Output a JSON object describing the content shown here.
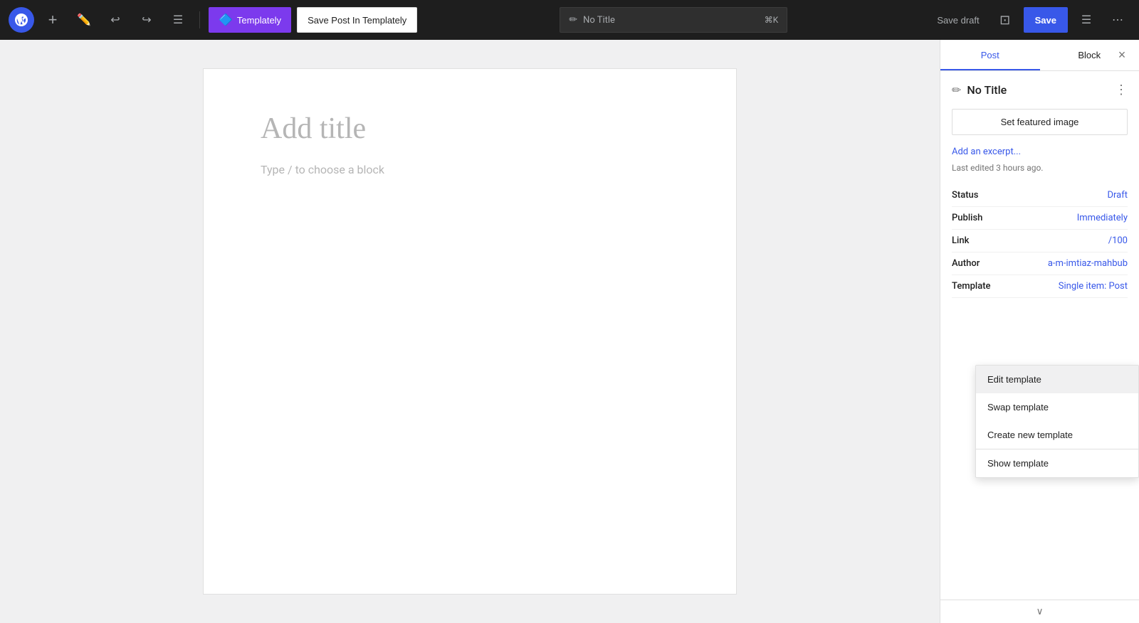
{
  "toolbar": {
    "wp_logo": "W",
    "add_label": "+",
    "edit_label": "✏",
    "undo_label": "↩",
    "redo_label": "↪",
    "list_label": "☰",
    "templately_label": "Templately",
    "save_templately_label": "Save Post In Templately",
    "title_placeholder": "No Title",
    "shortcut": "⌘K",
    "save_draft_label": "Save draft",
    "save_label": "Save",
    "preview_icon": "⊡",
    "settings_icon": "☰",
    "more_icon": "⋯"
  },
  "editor": {
    "title_placeholder": "Add title",
    "body_placeholder": "Type / to choose a block"
  },
  "sidebar": {
    "tab_post": "Post",
    "tab_block": "Block",
    "close_icon": "×",
    "pencil_icon": "✏",
    "post_title": "No Title",
    "more_icon": "⋮",
    "featured_image_btn": "Set featured image",
    "add_excerpt_link": "Add an excerpt...",
    "last_edited": "Last edited 3 hours ago.",
    "status_label": "Status",
    "status_value": "Draft",
    "publish_label": "Publish",
    "publish_value": "Immediately",
    "link_label": "Link",
    "link_value": "/100",
    "author_label": "Author",
    "author_value": "a-m-imtiaz-mahbub",
    "template_label": "Template",
    "template_value": "Single item: Post",
    "scroll_down_icon": "∨"
  },
  "template_dropdown": {
    "edit_template": "Edit template",
    "swap_template": "Swap template",
    "create_new_template": "Create new template",
    "show_template": "Show template"
  }
}
